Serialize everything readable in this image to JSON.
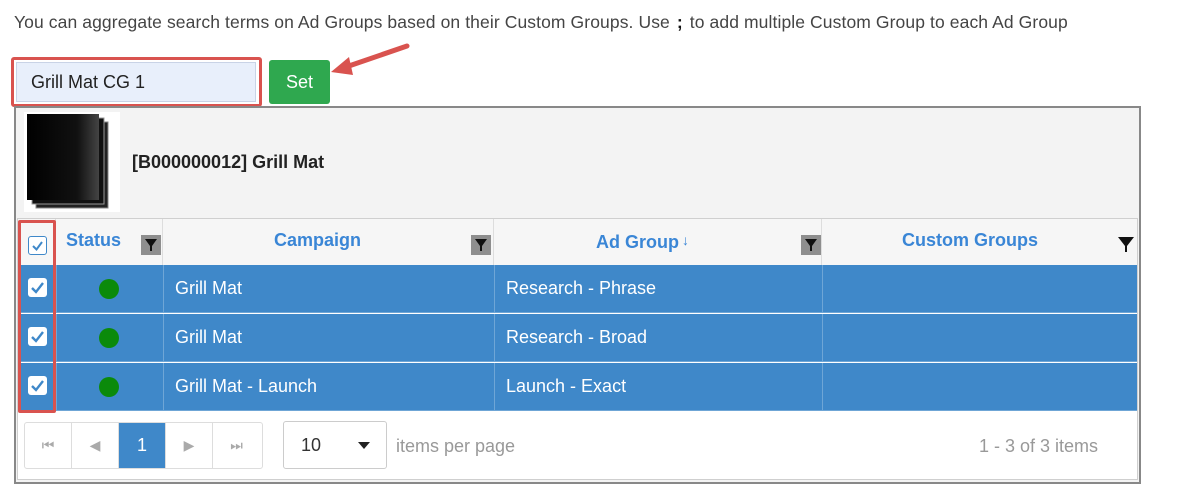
{
  "intro": {
    "before": "You can aggregate search terms on Ad Groups based on their Custom Groups. Use",
    "sep": ";",
    "after": "to add multiple Custom Group to each Ad Group"
  },
  "custom_group_input": {
    "value": "Grill Mat CG 1"
  },
  "set_button": {
    "label": "Set"
  },
  "product": {
    "title": "[B000000012] Grill Mat",
    "thumbnail_icon": "grill-mat-image"
  },
  "grid": {
    "columns": [
      {
        "label": "Status"
      },
      {
        "label": "Campaign"
      },
      {
        "label": "Ad Group",
        "sort_indicator": "↓"
      },
      {
        "label": "Custom Groups"
      }
    ],
    "rows": [
      {
        "checked": true,
        "status_color": "#0b8a0b",
        "campaign": "Grill Mat",
        "ad_group": "Research - Phrase",
        "custom_groups": ""
      },
      {
        "checked": true,
        "status_color": "#0b8a0b",
        "campaign": "Grill Mat",
        "ad_group": "Research - Broad",
        "custom_groups": ""
      },
      {
        "checked": true,
        "status_color": "#0b8a0b",
        "campaign": "Grill Mat - Launch",
        "ad_group": "Launch - Exact",
        "custom_groups": ""
      }
    ]
  },
  "pager": {
    "first": "⏮",
    "prev": "◀",
    "current": "1",
    "next": "▶",
    "last": "⏭",
    "page_size": "10",
    "items_per_page_label": "items per page",
    "range_label": "1 - 3 of 3 items"
  },
  "colors": {
    "selected_row": "#3f88c9",
    "status_active": "#0b8a0b",
    "set_button": "#2fa84f",
    "callout": "#d9534f"
  }
}
